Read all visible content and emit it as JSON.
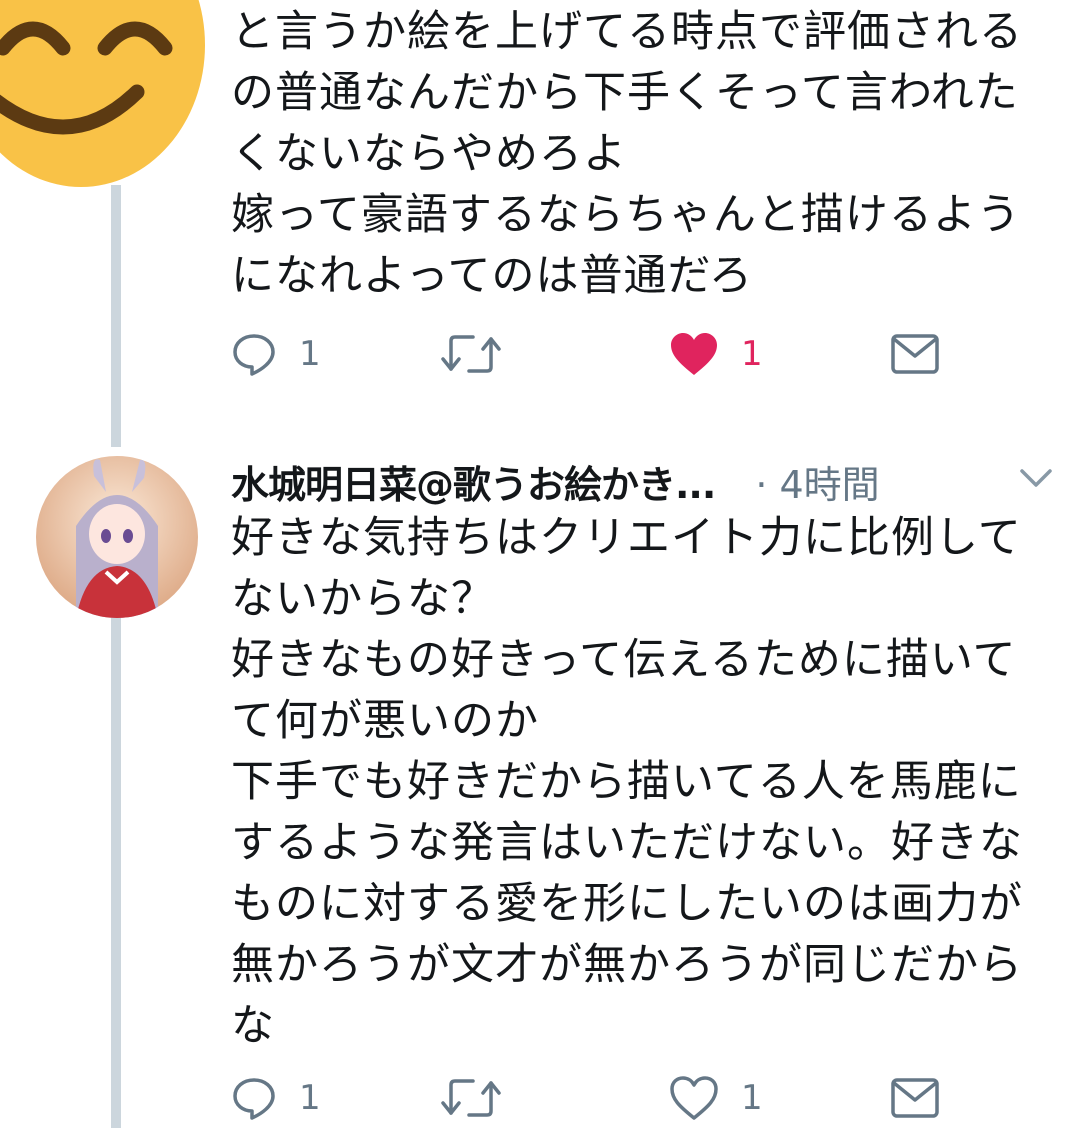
{
  "tweet1": {
    "text": "と言うか絵を上げてる時点で評価される\nの普通なんだから下手くそって言われた\nくないならやめろよ\n嫁って豪語するならちゃんと描けるよう\nになれよってのは普通だろ",
    "reply_count": "1",
    "like_count": "1",
    "liked": true,
    "avatar_icon": "smiling-emoji-icon"
  },
  "tweet2": {
    "display_name": "水城明日菜@歌うお絵かき...",
    "time": "· 4時間",
    "text": "好きな気持ちはクリエイト力に比例して\nないからな？\n好きなもの好きって伝えるために描いて\nて何が悪いのか\n下手でも好きだから描いてる人を馬鹿に\nするような発言はいただけない。好きな\nものに対する愛を形にしたいのは画力が\n無かろうが文才が無かろうが同じだから\nな",
    "reply_count": "1",
    "like_count": "1",
    "liked": false
  },
  "colors": {
    "text": "#14171a",
    "secondary": "#657786",
    "like_active": "#e0245e",
    "thread_line": "#ccd6dd",
    "emoji_face": "#f9c247"
  }
}
